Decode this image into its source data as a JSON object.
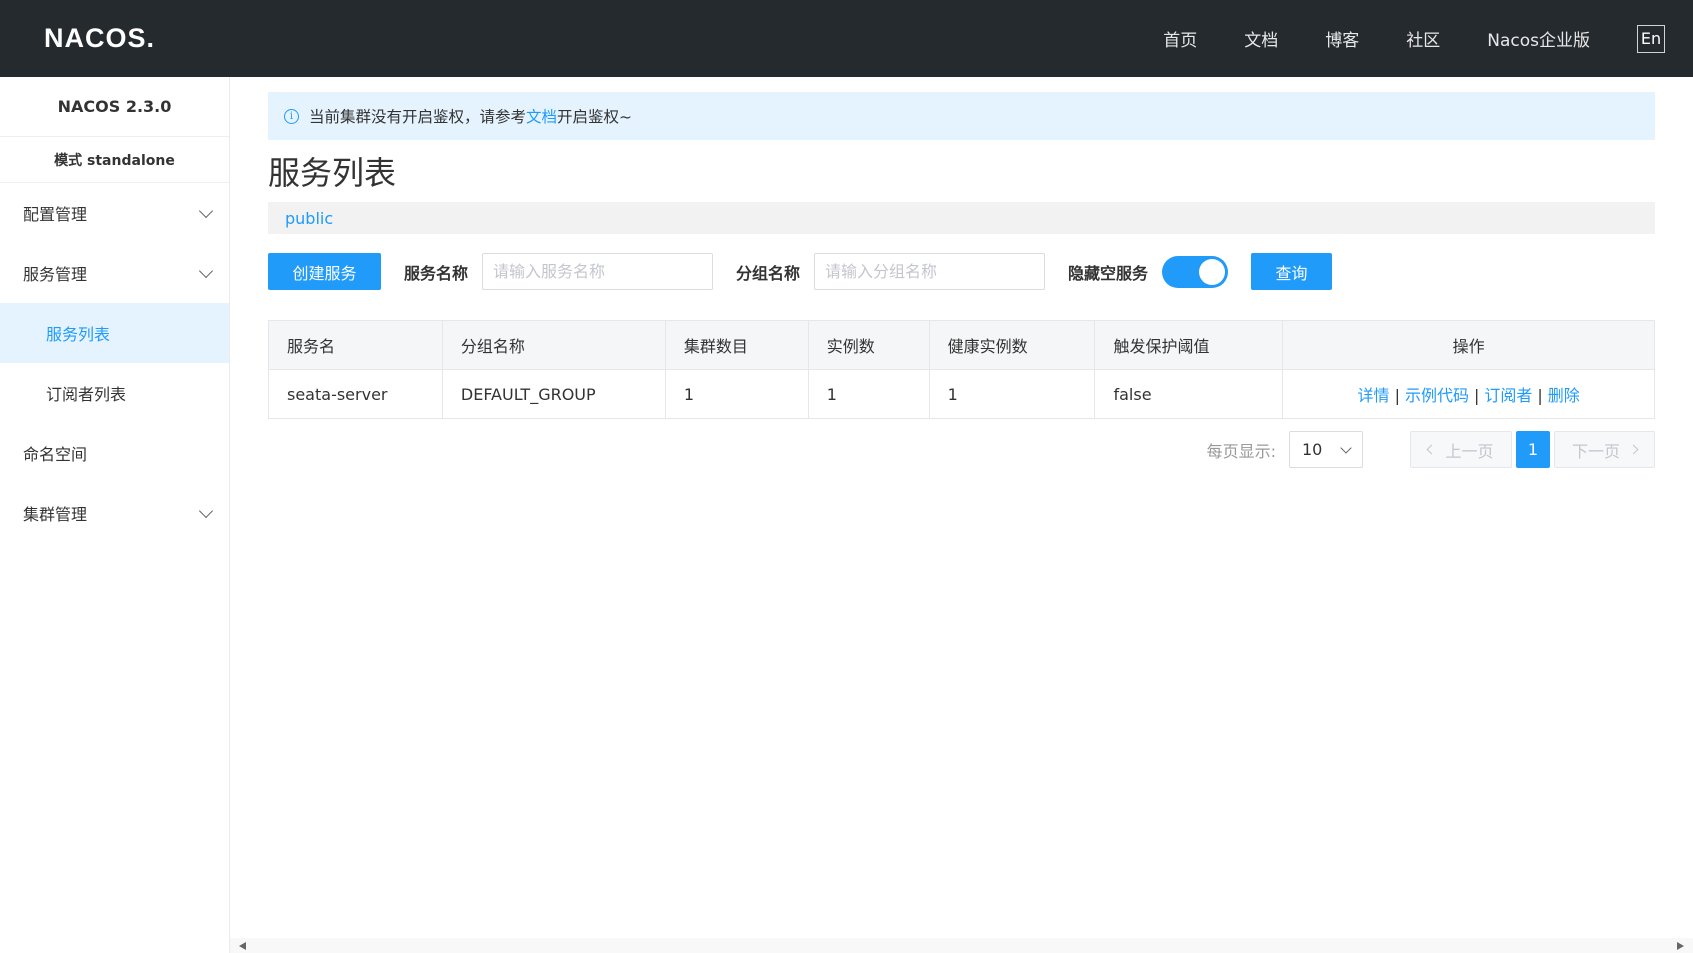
{
  "header": {
    "logo": "NACOS.",
    "nav": [
      "首页",
      "文档",
      "博客",
      "社区",
      "Nacos企业版"
    ],
    "lang": "En"
  },
  "sidebar": {
    "version": "NACOS 2.3.0",
    "mode": "模式 standalone",
    "config_mgmt": "配置管理",
    "service_mgmt": "服务管理",
    "service_list": "服务列表",
    "subscriber_list": "订阅者列表",
    "namespace": "命名空间",
    "cluster_mgmt": "集群管理"
  },
  "notice": {
    "before": "当前集群没有开启鉴权，请参考",
    "link": "文档",
    "after": "开启鉴权~"
  },
  "page": {
    "title": "服务列表",
    "namespace": "public"
  },
  "toolbar": {
    "create": "创建服务",
    "service_name_label": "服务名称",
    "service_name_placeholder": "请输入服务名称",
    "group_name_label": "分组名称",
    "group_name_placeholder": "请输入分组名称",
    "hide_empty_label": "隐藏空服务",
    "hide_empty_on": true,
    "query": "查询"
  },
  "table": {
    "headers": [
      "服务名",
      "分组名称",
      "集群数目",
      "实例数",
      "健康实例数",
      "触发保护阈值",
      "操作"
    ],
    "rows": [
      {
        "service": "seata-server",
        "group": "DEFAULT_GROUP",
        "clusters": "1",
        "instances": "1",
        "healthy": "1",
        "threshold": "false"
      }
    ],
    "actions": [
      "详情",
      "示例代码",
      "订阅者",
      "删除"
    ],
    "separator": "|"
  },
  "pager": {
    "label": "每页显示:",
    "page_size": "10",
    "prev": "上一页",
    "current": "1",
    "next": "下一页"
  },
  "colors": {
    "primary": "#209bfa",
    "topbar": "#252a2f",
    "active_bg": "#e4f3fe"
  }
}
